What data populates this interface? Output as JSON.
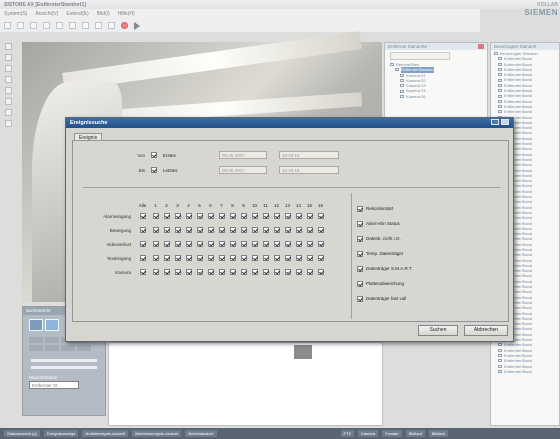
{
  "app": {
    "title": "SISTORE AX [EntfernterStandort1]",
    "logo_line1": "KOLLAB",
    "logo_line2": "SIEMEN"
  },
  "menu": [
    "System(S)",
    "Ansicht(V)",
    "Extend(E)",
    "Bild(I)",
    "Hilfe(H)"
  ],
  "panels": {
    "remote": {
      "title": "Entfernte Standorte",
      "items": [
        "RemoteSites",
        "EntfernterStandort",
        "Kamera 01",
        "Kamera 02",
        "Kamera 03",
        "Kamera 04",
        "Kamera 05"
      ]
    },
    "preferred": {
      "title": "Bevorzugter Standort",
      "root": "Bevorzugter Standort",
      "items": [
        "EntfernterStand",
        "EntfernterStand",
        "EntfernterStand",
        "EntfernterStand",
        "EntfernterStand",
        "EntfernterStand",
        "EntfernterStand",
        "EntfernterStand",
        "EntfernterStand",
        "EntfernterStand",
        "EntfernterStand",
        "EntfernterStand",
        "EntfernterStand",
        "EntfernterStand",
        "EntfernterStand",
        "EntfernterStand",
        "EntfernterStand",
        "EntfernterStand",
        "EntfernterStand",
        "EntfernterStand",
        "EntfernterStand",
        "EntfernterStand",
        "EntfernterStand",
        "EntfernterStand",
        "EntfernterStand",
        "EntfernterStand",
        "EntfernterStand",
        "EntfernterStand",
        "EntfernterStand",
        "EntfernterStand",
        "EntfernterStand",
        "EntfernterStand",
        "EntfernterStand",
        "EntfernterStand",
        "EntfernterStand",
        "EntfernterStand",
        "EntfernterStand",
        "EntfernterStand",
        "EntfernterStand",
        "EntfernterStand",
        "EntfernterStand",
        "EntfernterStand",
        "EntfernterStand",
        "EntfernterStand",
        "EntfernterStand",
        "EntfernterStand",
        "EntfernterStand",
        "EntfernterStand",
        "EntfernterStand",
        "EntfernterStand",
        "EntfernterStand",
        "EntfernterStand",
        "EntfernterStand",
        "EntfernterStand",
        "EntfernterStand",
        "EntfernterStand",
        "EntfernterStand",
        "EntfernterStand",
        "EntfernterStand",
        "EntfernterStand"
      ]
    }
  },
  "overview": {
    "title": "Suchansicht",
    "site_label": "Standortname",
    "site_value": "Entfernter St"
  },
  "dialog": {
    "title": "Ereignissuche",
    "tab": "Ereignis",
    "from_label": "Von",
    "from_check": "Erstes",
    "to_label": "Bis",
    "to_check": "Letztes",
    "from_date": "09.05.2007",
    "from_time": "16:40:16",
    "to_date": "09.05.2007",
    "to_time": "16:40:16",
    "col_all": "Alle",
    "cols": [
      "1",
      "2",
      "3",
      "4",
      "5",
      "6",
      "7",
      "8",
      "9",
      "10",
      "11",
      "12",
      "13",
      "14",
      "15",
      "16"
    ],
    "rows": [
      "Alarmeingang",
      "Bewegung",
      "Videoverlust",
      "Texteingang",
      "Kamera"
    ],
    "options": [
      "Rekorderstart",
      "Alarm-Ein Status",
      "Datenb. nicht i.O.",
      "Temp. Datenträger",
      "Datenträger S.M.A.R.T",
      "Plattenabweichung",
      "Datenträger fast voll"
    ],
    "search_btn": "Suchen",
    "cancel_btn": "Abbrechen"
  },
  "status": [
    "Statusansicht (p)",
    "Ereignisanzeige",
    "Notfallereignis-Ansicht",
    "Betriebsereignis-Ansicht",
    "Berichtansicht",
    "PTZ",
    "Kamera",
    "Fenster",
    "Bildlauf",
    "Bildlauf"
  ]
}
